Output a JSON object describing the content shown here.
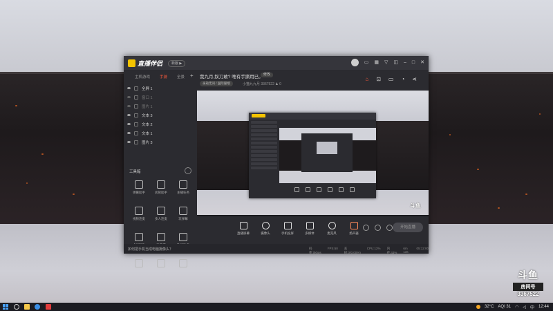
{
  "app": {
    "name": "直播伴侣",
    "version_badge": "新版 ▶"
  },
  "titlebar": {
    "icons": [
      "avatar",
      "chat-icon",
      "grid-icon",
      "shirt-icon",
      "gift-icon",
      "minimize-icon",
      "maximize-icon",
      "close-icon"
    ]
  },
  "sidebar": {
    "tabs": [
      {
        "label": "主机游戏",
        "active": false
      },
      {
        "label": "手游",
        "active": true
      },
      {
        "label": "全景",
        "active": false
      }
    ],
    "add_label": "+",
    "sources": [
      {
        "label": "全屏 1",
        "dim": false
      },
      {
        "label": "窗口 1",
        "dim": true
      },
      {
        "label": "图片 1",
        "dim": true
      },
      {
        "label": "文本 3",
        "dim": false
      },
      {
        "label": "文本 2",
        "dim": false
      },
      {
        "label": "文本 1",
        "dim": false
      },
      {
        "label": "图片 3",
        "dim": false
      }
    ],
    "tools_title": "工具箱",
    "tools": [
      "弹幕助手",
      "房管助手",
      "主播任务",
      "视频连麦",
      "多人连麦",
      "玩弹幕",
      "虚拟形象",
      "弹幕库",
      "歌词助手",
      "",
      "",
      ""
    ],
    "tip": "如何把手机当成电脑摄像头？"
  },
  "room": {
    "title": "我九月,奴刀敢? 唯有手撕用已。",
    "edit_label": "修改",
    "category": "永劫无间 / 国际服端",
    "streamer": "小猫九九月",
    "room_id": "3367522",
    "online": "0"
  },
  "preview": {
    "watermark": "斗鱼"
  },
  "bottombar": {
    "items": [
      "直播屏幕",
      "摄像头",
      "手机投屏",
      "多媒体",
      "麦克风",
      "扬声器"
    ],
    "start_label": "开始直播"
  },
  "statusbar": [
    "码率:0kbps",
    "FPS:60",
    "丢帧:0(0.00%)",
    "CPU:12%",
    "内存:43%",
    "6m 13s",
    "05:12:00"
  ],
  "background_logo": {
    "line1": "斗鱼",
    "line2": "房间号",
    "line3": "3367522"
  },
  "taskbar": {
    "temperature": "32°C",
    "aqi": "AQI 31",
    "ime": "中",
    "time": "12:44"
  },
  "colors": {
    "accent": "#ff5a3c",
    "brand": "#f5c400",
    "window": "#2b2b30"
  }
}
